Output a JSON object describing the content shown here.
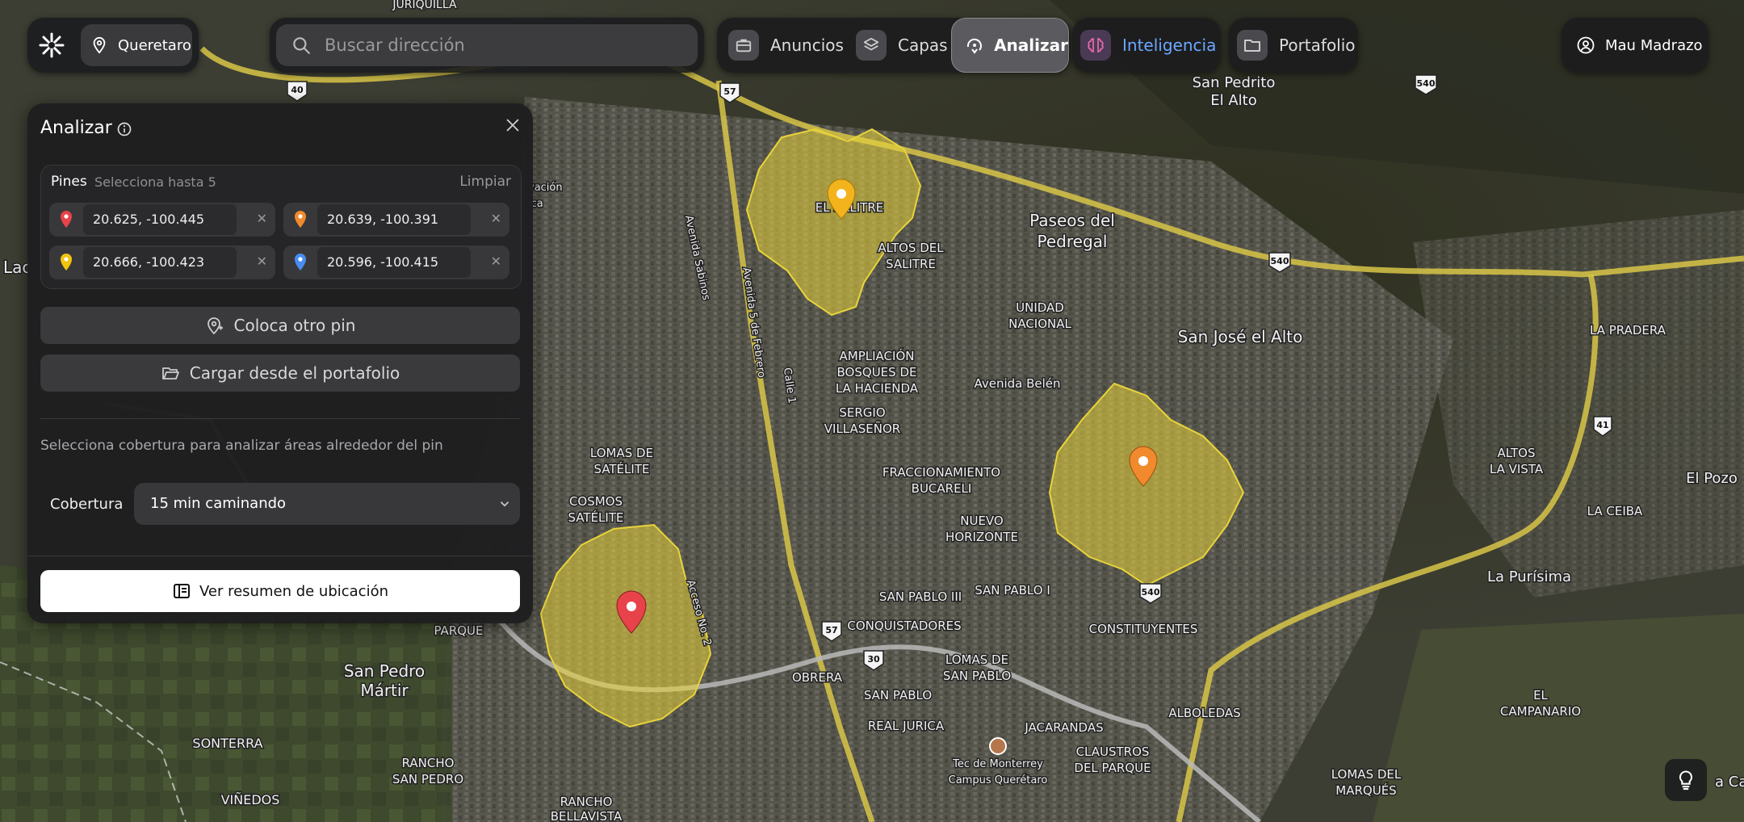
{
  "header": {
    "location_label": "Queretaro",
    "search_placeholder": "Buscar dirección",
    "nav": [
      {
        "label": "Anuncios",
        "icon": "briefcase-icon"
      },
      {
        "label": "Capas",
        "icon": "layers-icon"
      },
      {
        "label": "Analizar",
        "icon": "analyze-icon",
        "active": true
      },
      {
        "label": "Inteligencia",
        "icon": "brain-icon",
        "accent": "#6aa8ff"
      },
      {
        "label": "Portafolio",
        "icon": "folder-icon"
      }
    ],
    "user_name": "Mau Madrazo"
  },
  "panel": {
    "title": "Analizar",
    "pins_label": "Pines",
    "pins_hint": "Selecciona hasta 5",
    "clear_label": "Limpiar",
    "pins": [
      {
        "coords": "20.625, -100.445",
        "color": "#e8434a"
      },
      {
        "coords": "20.639, -100.391",
        "color": "#f08a2c"
      },
      {
        "coords": "20.666, -100.423",
        "color": "#f2c40c"
      },
      {
        "coords": "20.596, -100.415",
        "color": "#4a8cf0"
      }
    ],
    "place_pin_label": "Coloca otro pin",
    "load_portfolio_label": "Cargar desde el portafolio",
    "coverage_hint": "Selecciona cobertura para analizar áreas alrededor del pin",
    "coverage_label": "Cobertura",
    "coverage_value": "15 min caminando",
    "summary_button": "Ver resumen de ubicación"
  },
  "map": {
    "place_labels": [
      "JURIQUILLA",
      "San Pedrito",
      "El Alto",
      "EL SALITRE",
      "ALTOS DEL",
      "SALITRE",
      "Paseos del",
      "Pedregal",
      "UNIDAD",
      "NACIONAL",
      "San José el Alto",
      "LA PRADERA",
      "AMPLIACIÓN",
      "BOSQUES DE",
      "LA HACIENDA",
      "Avenida Belén",
      "SERGIO",
      "VILLASEÑOR",
      "LOMAS DE",
      "SATÉLITE",
      "FRACCIONAMIENTO",
      "BUCARELI",
      "ALTOS",
      "LA VISTA",
      "El Pozo",
      "COSMOS",
      "SATÉLITE",
      "NUEVO",
      "HORIZONTE",
      "LA CEIBA",
      "La Purísima",
      "SAN PABLO III",
      "SAN PABLO I",
      "CONQUISTADORES",
      "CONSTITUYENTES",
      "PARQUE",
      "San Pedro",
      "Mártir",
      "OBRERA",
      "LOMAS DE",
      "SAN PABLO",
      "SAN PABLO",
      "ALBOLEDAS",
      "EL",
      "CAMPANARIO",
      "REAL JURICA",
      "JACARANDAS",
      "SONTERRA",
      "RANCHO",
      "SAN PEDRO",
      "CLAUSTROS",
      "DEL PARQUE",
      "Tec de Monterrey",
      "Campus Querétaro",
      "VIÑEDOS",
      "LOMAS DEL",
      "MARQUÉS",
      "RANCHO",
      "BELLAVISTA",
      "Avenida Sabinos",
      "Avenida 5 de Febrero",
      "Acceso No. 2",
      "Calle 1",
      "Lac",
      "vación",
      "ica",
      "a Ca"
    ],
    "shields": [
      "40",
      "57",
      "540",
      "540",
      "41",
      "540",
      "57",
      "30"
    ],
    "isochrone_color": "#e9d43a"
  },
  "hint_button_icon": "lightbulb-icon"
}
